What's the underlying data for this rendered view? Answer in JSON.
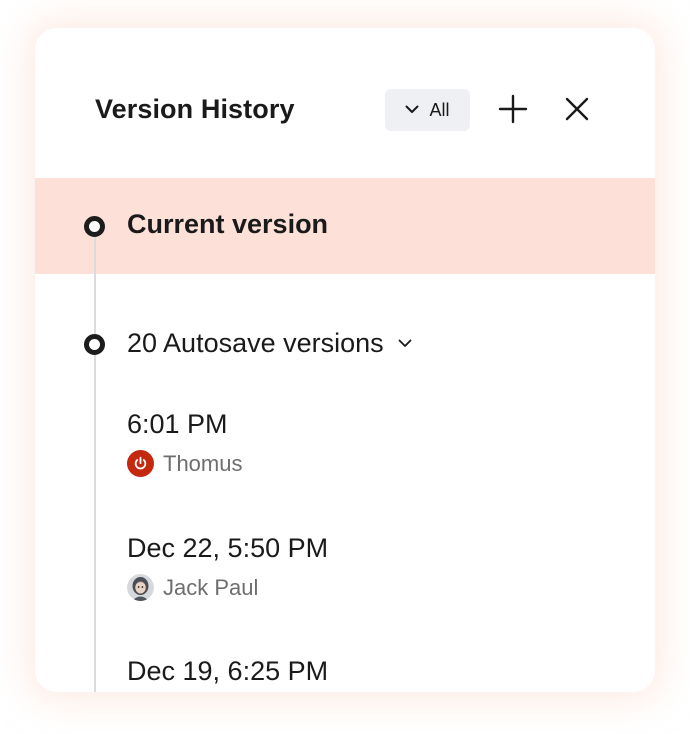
{
  "header": {
    "title": "Version History",
    "filter_label": "All",
    "filter_icon": "chevron-down-icon",
    "add_icon": "plus-icon",
    "close_icon": "close-icon"
  },
  "timeline": {
    "current_version_label": "Current version",
    "autosave_group_label": "20 Autosave versions",
    "autosave_group_icon": "chevron-down-icon",
    "versions": [
      {
        "time": "6:01 PM",
        "author": "Thomus",
        "avatar": "power-icon-avatar"
      },
      {
        "time": "Dec 22, 5:50 PM",
        "author": "Jack Paul",
        "avatar": "user-photo-avatar"
      },
      {
        "time": "Dec 19, 6:25 PM"
      }
    ]
  },
  "colors": {
    "current_highlight": "#fde1d9",
    "filter_bg": "#eef0f3",
    "thomus_avatar": "#c4280f",
    "secondary_text": "#6e6e6e"
  }
}
